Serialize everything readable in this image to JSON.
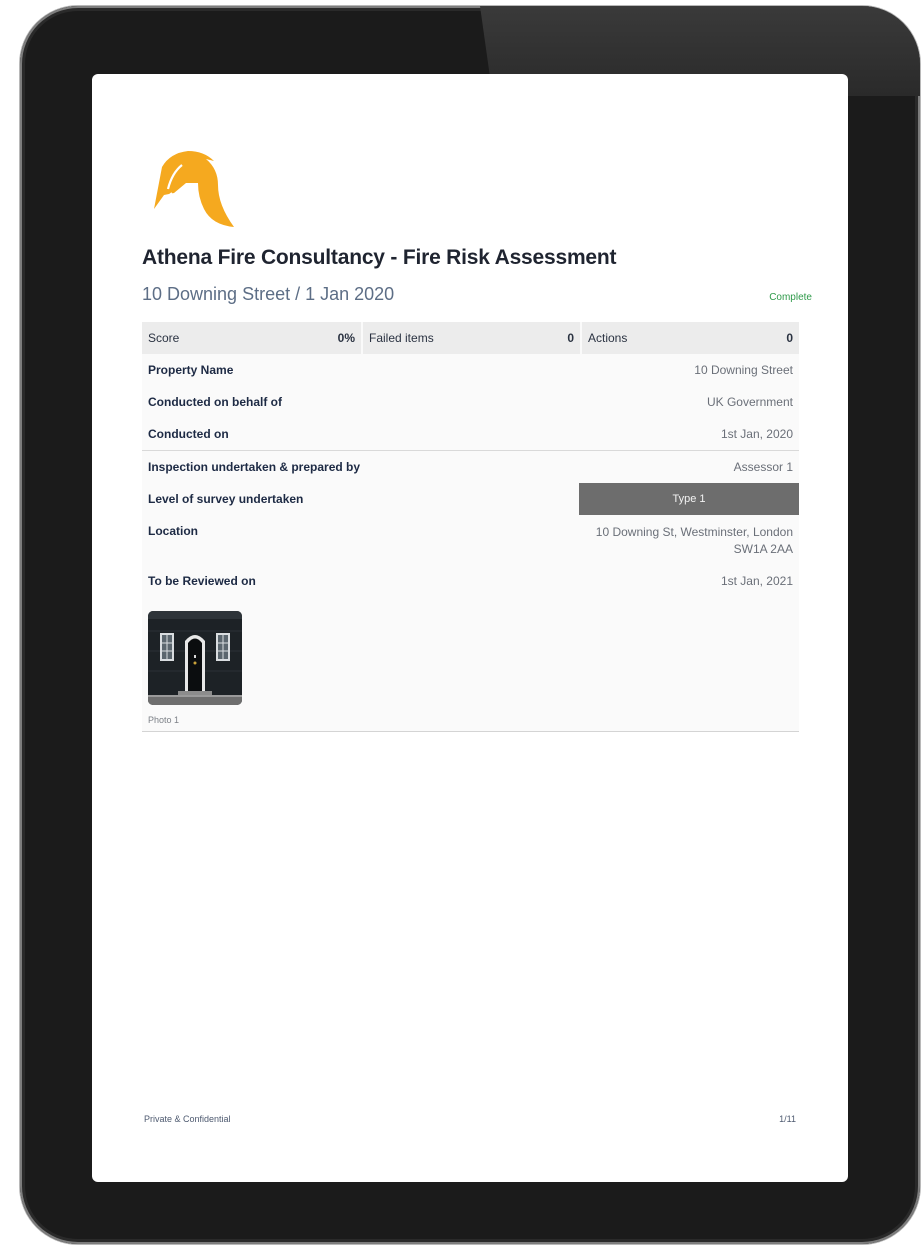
{
  "report": {
    "title": "Athena Fire Consultancy - Fire Risk Assessment",
    "subtitle": "10 Downing Street / 1 Jan 2020",
    "status": "Complete"
  },
  "summary": {
    "score_label": "Score",
    "score_value": "0%",
    "failed_label": "Failed items",
    "failed_value": "0",
    "actions_label": "Actions",
    "actions_value": "0"
  },
  "fields": {
    "property_name_label": "Property Name",
    "property_name_value": "10 Downing Street",
    "behalf_label": "Conducted on behalf of",
    "behalf_value": "UK Government",
    "conducted_on_label": "Conducted on",
    "conducted_on_value": "1st Jan, 2020",
    "prepared_by_label": "Inspection undertaken & prepared by",
    "prepared_by_value": "Assessor 1",
    "survey_level_label": "Level of survey undertaken",
    "survey_level_value": "Type 1",
    "location_label": "Location",
    "location_line1": "10 Downing St, Westminster, London",
    "location_line2": "SW1A 2AA",
    "review_label": "To be Reviewed on",
    "review_value": "1st Jan, 2021"
  },
  "media": {
    "photo_caption": "Photo 1",
    "photo_icon": "building-door-photo"
  },
  "footer": {
    "confidential": "Private & Confidential",
    "page_indicator": "1/11"
  },
  "icons": {
    "logo": "spartan-helmet-icon"
  },
  "colors": {
    "logo_orange": "#f5a91f",
    "status_green": "#2f9a4a",
    "badge_gray": "#6d6d6d",
    "title_dark": "#1f2430",
    "subtitle_blue_gray": "#5d6e86"
  }
}
